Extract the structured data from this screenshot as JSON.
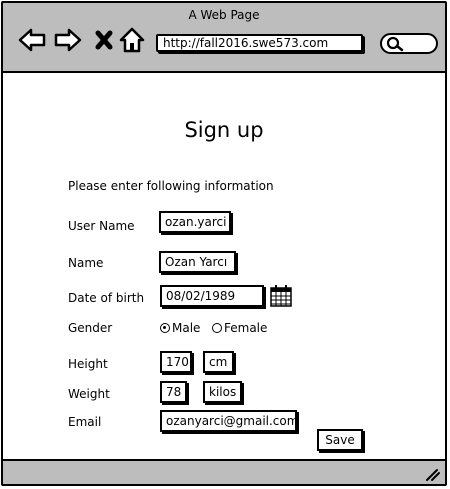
{
  "window": {
    "title": "A Web Page"
  },
  "browser": {
    "url": "http://fall2016.swe573.com",
    "icons": [
      "back-arrow-icon",
      "forward-arrow-icon",
      "close-x-icon",
      "home-icon",
      "search-icon"
    ]
  },
  "form": {
    "heading": "Sign up",
    "intro": "Please enter following information",
    "username": {
      "label": "User Name",
      "value": "ozan.yarci"
    },
    "name": {
      "label": "Name",
      "value": "Ozan Yarcı"
    },
    "dob": {
      "label": "Date of birth",
      "value": "08/02/1989"
    },
    "gender": {
      "label": "Gender",
      "options": [
        "Male",
        "Female"
      ],
      "selected": "Male"
    },
    "height": {
      "label": "Height",
      "value": "170",
      "unit": "cm"
    },
    "weight": {
      "label": "Weight",
      "value": "78",
      "unit": "kilos"
    },
    "email": {
      "label": "Email",
      "value": "ozanyarci@gmail.com"
    },
    "save_label": "Save"
  }
}
